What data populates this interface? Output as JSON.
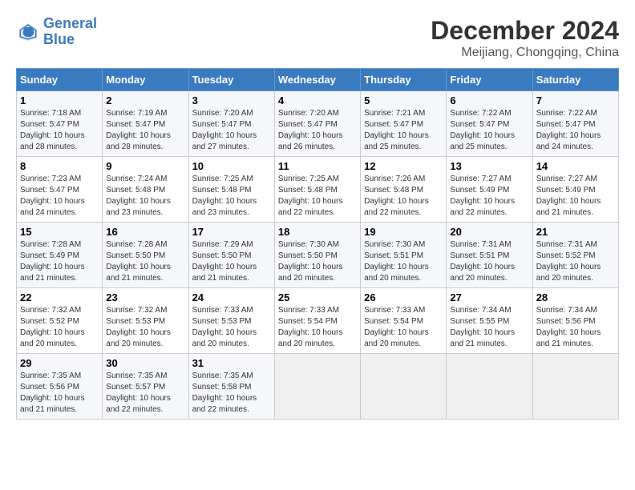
{
  "logo": {
    "line1": "General",
    "line2": "Blue"
  },
  "title": "December 2024",
  "location": "Meijiang, Chongqing, China",
  "weekdays": [
    "Sunday",
    "Monday",
    "Tuesday",
    "Wednesday",
    "Thursday",
    "Friday",
    "Saturday"
  ],
  "weeks": [
    [
      {
        "day": "1",
        "sunrise": "7:18 AM",
        "sunset": "5:47 PM",
        "daylight": "10 hours and 28 minutes."
      },
      {
        "day": "2",
        "sunrise": "7:19 AM",
        "sunset": "5:47 PM",
        "daylight": "10 hours and 28 minutes."
      },
      {
        "day": "3",
        "sunrise": "7:20 AM",
        "sunset": "5:47 PM",
        "daylight": "10 hours and 27 minutes."
      },
      {
        "day": "4",
        "sunrise": "7:20 AM",
        "sunset": "5:47 PM",
        "daylight": "10 hours and 26 minutes."
      },
      {
        "day": "5",
        "sunrise": "7:21 AM",
        "sunset": "5:47 PM",
        "daylight": "10 hours and 25 minutes."
      },
      {
        "day": "6",
        "sunrise": "7:22 AM",
        "sunset": "5:47 PM",
        "daylight": "10 hours and 25 minutes."
      },
      {
        "day": "7",
        "sunrise": "7:22 AM",
        "sunset": "5:47 PM",
        "daylight": "10 hours and 24 minutes."
      }
    ],
    [
      {
        "day": "8",
        "sunrise": "7:23 AM",
        "sunset": "5:47 PM",
        "daylight": "10 hours and 24 minutes."
      },
      {
        "day": "9",
        "sunrise": "7:24 AM",
        "sunset": "5:48 PM",
        "daylight": "10 hours and 23 minutes."
      },
      {
        "day": "10",
        "sunrise": "7:25 AM",
        "sunset": "5:48 PM",
        "daylight": "10 hours and 23 minutes."
      },
      {
        "day": "11",
        "sunrise": "7:25 AM",
        "sunset": "5:48 PM",
        "daylight": "10 hours and 22 minutes."
      },
      {
        "day": "12",
        "sunrise": "7:26 AM",
        "sunset": "5:48 PM",
        "daylight": "10 hours and 22 minutes."
      },
      {
        "day": "13",
        "sunrise": "7:27 AM",
        "sunset": "5:49 PM",
        "daylight": "10 hours and 22 minutes."
      },
      {
        "day": "14",
        "sunrise": "7:27 AM",
        "sunset": "5:49 PM",
        "daylight": "10 hours and 21 minutes."
      }
    ],
    [
      {
        "day": "15",
        "sunrise": "7:28 AM",
        "sunset": "5:49 PM",
        "daylight": "10 hours and 21 minutes."
      },
      {
        "day": "16",
        "sunrise": "7:28 AM",
        "sunset": "5:50 PM",
        "daylight": "10 hours and 21 minutes."
      },
      {
        "day": "17",
        "sunrise": "7:29 AM",
        "sunset": "5:50 PM",
        "daylight": "10 hours and 21 minutes."
      },
      {
        "day": "18",
        "sunrise": "7:30 AM",
        "sunset": "5:50 PM",
        "daylight": "10 hours and 20 minutes."
      },
      {
        "day": "19",
        "sunrise": "7:30 AM",
        "sunset": "5:51 PM",
        "daylight": "10 hours and 20 minutes."
      },
      {
        "day": "20",
        "sunrise": "7:31 AM",
        "sunset": "5:51 PM",
        "daylight": "10 hours and 20 minutes."
      },
      {
        "day": "21",
        "sunrise": "7:31 AM",
        "sunset": "5:52 PM",
        "daylight": "10 hours and 20 minutes."
      }
    ],
    [
      {
        "day": "22",
        "sunrise": "7:32 AM",
        "sunset": "5:52 PM",
        "daylight": "10 hours and 20 minutes."
      },
      {
        "day": "23",
        "sunrise": "7:32 AM",
        "sunset": "5:53 PM",
        "daylight": "10 hours and 20 minutes."
      },
      {
        "day": "24",
        "sunrise": "7:33 AM",
        "sunset": "5:53 PM",
        "daylight": "10 hours and 20 minutes."
      },
      {
        "day": "25",
        "sunrise": "7:33 AM",
        "sunset": "5:54 PM",
        "daylight": "10 hours and 20 minutes."
      },
      {
        "day": "26",
        "sunrise": "7:33 AM",
        "sunset": "5:54 PM",
        "daylight": "10 hours and 20 minutes."
      },
      {
        "day": "27",
        "sunrise": "7:34 AM",
        "sunset": "5:55 PM",
        "daylight": "10 hours and 21 minutes."
      },
      {
        "day": "28",
        "sunrise": "7:34 AM",
        "sunset": "5:56 PM",
        "daylight": "10 hours and 21 minutes."
      }
    ],
    [
      {
        "day": "29",
        "sunrise": "7:35 AM",
        "sunset": "5:56 PM",
        "daylight": "10 hours and 21 minutes."
      },
      {
        "day": "30",
        "sunrise": "7:35 AM",
        "sunset": "5:57 PM",
        "daylight": "10 hours and 22 minutes."
      },
      {
        "day": "31",
        "sunrise": "7:35 AM",
        "sunset": "5:58 PM",
        "daylight": "10 hours and 22 minutes."
      },
      null,
      null,
      null,
      null
    ]
  ],
  "labels": {
    "sunrise": "Sunrise:",
    "sunset": "Sunset:",
    "daylight": "Daylight:"
  }
}
